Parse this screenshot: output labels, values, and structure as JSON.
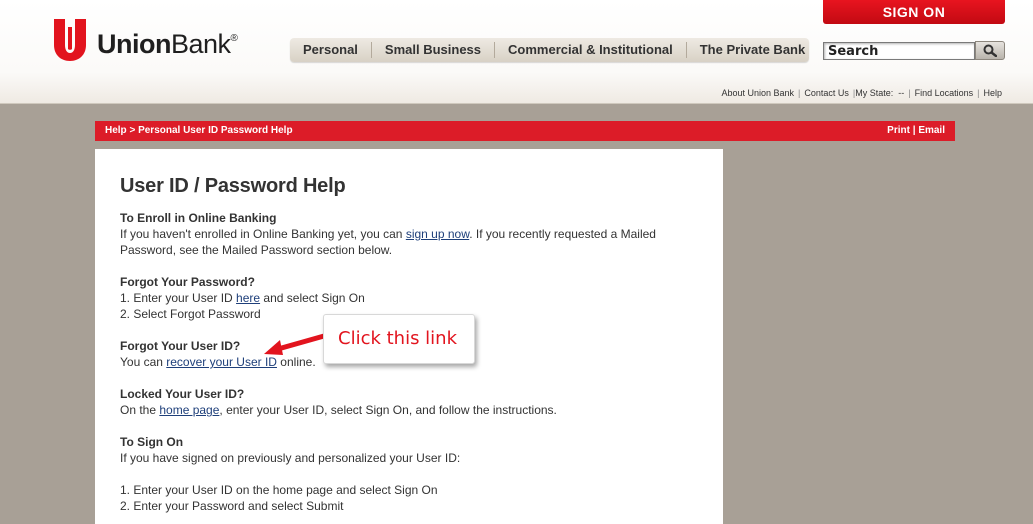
{
  "brand": {
    "name_bold": "Union",
    "name_rest": "Bank",
    "reg": "®",
    "color": "#e2141e"
  },
  "signon": {
    "label": "SIGN ON"
  },
  "nav": {
    "items": [
      {
        "label": "Personal"
      },
      {
        "label": "Small Business"
      },
      {
        "label": "Commercial & Institutional"
      },
      {
        "label": "The Private Bank"
      }
    ]
  },
  "search": {
    "value": "Search",
    "icon": "search-icon"
  },
  "utility": {
    "about": "About Union Bank",
    "contact": "Contact Us",
    "state_label": "My State:",
    "state_value": "--",
    "locations": "Find Locations",
    "help": "Help"
  },
  "breadcrumb": {
    "text": "Help > Personal User ID Password Help",
    "print": "Print",
    "divider": "|",
    "email": "Email",
    "bar_color": "#dc1c28"
  },
  "page": {
    "title": "User ID / Password Help",
    "sections": [
      {
        "heading": "To Enroll in Online Banking",
        "p1_before": "If you haven't enrolled in Online Banking yet, you can ",
        "p1_link": "sign up now",
        "p1_after": ". If you recently requested a Mailed",
        "p2": "Password, see the Mailed Password section below."
      },
      {
        "heading": "Forgot Your Password?",
        "step1_before": "1. Enter your User ID ",
        "step1_link": "here",
        "step1_after": " and select Sign On",
        "step2": "2. Select Forgot Password"
      },
      {
        "heading": "Forgot Your User ID?",
        "p_before": "You can ",
        "p_link": "recover your User ID",
        "p_after": " online."
      },
      {
        "heading": "Locked Your User ID?",
        "p_before": "On the ",
        "p_link": "home page",
        "p_after": ", enter your User ID, select Sign On, and follow the instructions."
      },
      {
        "heading": "To Sign On",
        "p": "If you have signed on previously and personalized your User ID:",
        "step1": "1. Enter your User ID on the home page and select Sign On",
        "step2": "2. Enter your Password and select Submit"
      }
    ]
  },
  "callout": {
    "text": "Click this link",
    "color": "#e2141e"
  }
}
